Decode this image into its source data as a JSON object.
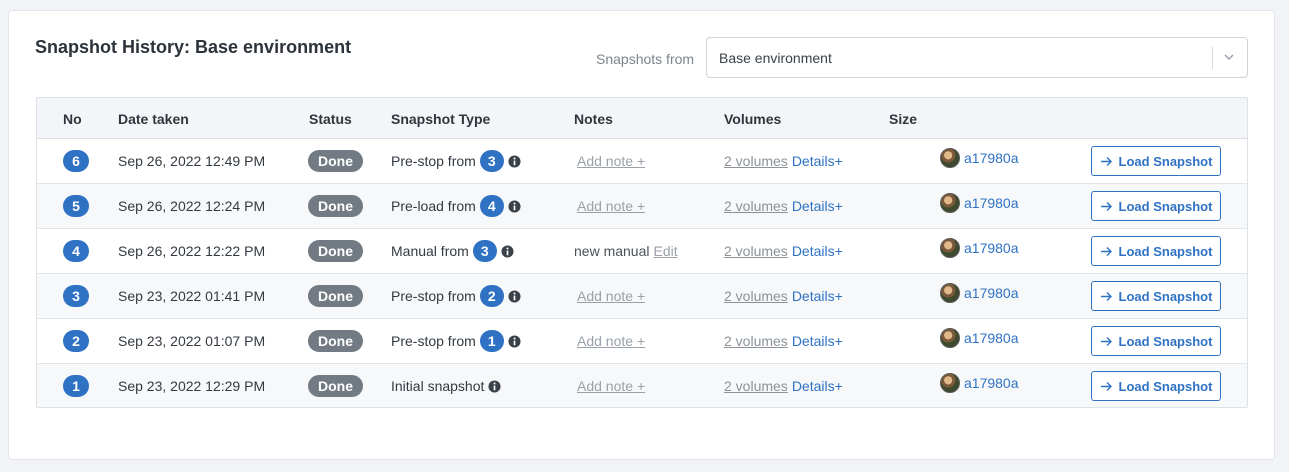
{
  "header": {
    "title": "Snapshot History: Base environment",
    "filter_label": "Snapshots from",
    "filter_value": "Base environment"
  },
  "table": {
    "columns": [
      "No",
      "Date taken",
      "Status",
      "Snapshot Type",
      "Notes",
      "Volumes",
      "Size"
    ],
    "rows": [
      {
        "no": "6",
        "date": "Sep 26, 2022 12:49 PM",
        "status": "Done",
        "type": "Pre-stop from",
        "from": "3",
        "note_kind": "add",
        "note": "Add note +",
        "note_edit": "",
        "volumes": "2 volumes",
        "details": "Details+",
        "user": "a17980a",
        "action": "Load Snapshot"
      },
      {
        "no": "5",
        "date": "Sep 26, 2022 12:24 PM",
        "status": "Done",
        "type": "Pre-load from",
        "from": "4",
        "note_kind": "add",
        "note": "Add note +",
        "note_edit": "",
        "volumes": "2 volumes",
        "details": "Details+",
        "user": "a17980a",
        "action": "Load Snapshot"
      },
      {
        "no": "4",
        "date": "Sep 26, 2022 12:22 PM",
        "status": "Done",
        "type": "Manual from",
        "from": "3",
        "note_kind": "text",
        "note": "new manual",
        "note_edit": "Edit",
        "volumes": "2 volumes",
        "details": "Details+",
        "user": "a17980a",
        "action": "Load Snapshot"
      },
      {
        "no": "3",
        "date": "Sep 23, 2022 01:41 PM",
        "status": "Done",
        "type": "Pre-stop from",
        "from": "2",
        "note_kind": "add",
        "note": "Add note +",
        "note_edit": "",
        "volumes": "2 volumes",
        "details": "Details+",
        "user": "a17980a",
        "action": "Load Snapshot"
      },
      {
        "no": "2",
        "date": "Sep 23, 2022 01:07 PM",
        "status": "Done",
        "type": "Pre-stop from",
        "from": "1",
        "note_kind": "add",
        "note": "Add note +",
        "note_edit": "",
        "volumes": "2 volumes",
        "details": "Details+",
        "user": "a17980a",
        "action": "Load Snapshot"
      },
      {
        "no": "1",
        "date": "Sep 23, 2022 12:29 PM",
        "status": "Done",
        "type": "Initial snapshot",
        "from": "",
        "note_kind": "add",
        "note": "Add note +",
        "note_edit": "",
        "volumes": "2 volumes",
        "details": "Details+",
        "user": "a17980a",
        "action": "Load Snapshot"
      }
    ]
  },
  "icons": {
    "info": "info-icon",
    "chevron": "chevron-down-icon",
    "arrow": "arrow-right-icon",
    "avatar": "user-avatar"
  },
  "colors": {
    "accent": "#2f72c4",
    "status_done": "#727a83"
  }
}
